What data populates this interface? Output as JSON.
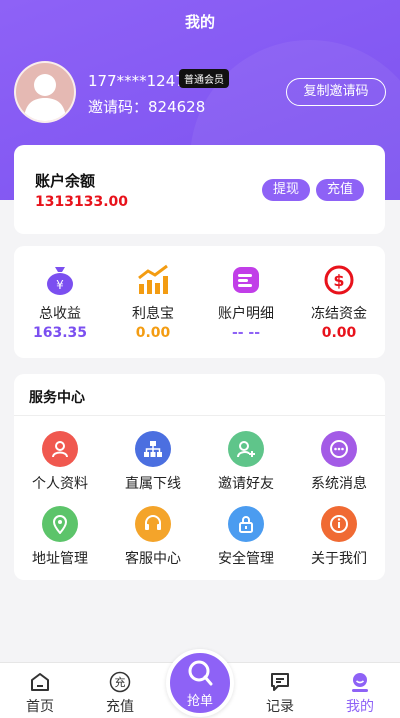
{
  "header": {
    "title": "我的"
  },
  "profile": {
    "phone": "177****1247",
    "member_badge": "普通会员",
    "invite_code": "邀请码：824628",
    "copy_invite_label": "复制邀请码"
  },
  "balance": {
    "label": "账户余额",
    "value": "1313133.00",
    "withdraw_label": "提现",
    "recharge_label": "充值"
  },
  "stats": [
    {
      "label": "总收益",
      "value": "163.35",
      "color": "#7b4ff0",
      "icon": "money-bag-icon"
    },
    {
      "label": "利息宝",
      "value": "0.00",
      "color": "#f39c12",
      "icon": "trend-chart-icon"
    },
    {
      "label": "账户明细",
      "value": "-- --",
      "color": "#8e62f6",
      "icon": "account-detail-icon"
    },
    {
      "label": "冻结资金",
      "value": "0.00",
      "color": "#e8121b",
      "icon": "dollar-coin-icon"
    }
  ],
  "services": {
    "title": "服务中心",
    "items": [
      {
        "label": "个人资料",
        "icon": "user-icon",
        "color": "#f0584f"
      },
      {
        "label": "直属下线",
        "icon": "hierarchy-icon",
        "color": "#4b6fe0"
      },
      {
        "label": "邀请好友",
        "icon": "add-user-icon",
        "color": "#5fc58a"
      },
      {
        "label": "系统消息",
        "icon": "message-icon",
        "color": "#a35be6"
      },
      {
        "label": "地址管理",
        "icon": "location-icon",
        "color": "#5cc46a"
      },
      {
        "label": "客服中心",
        "icon": "headset-icon",
        "color": "#f4a42a"
      },
      {
        "label": "安全管理",
        "icon": "lock-icon",
        "color": "#4b9cf0"
      },
      {
        "label": "关于我们",
        "icon": "info-icon",
        "color": "#f06a33"
      }
    ]
  },
  "tabbar": {
    "home": "首页",
    "recharge": "充值",
    "recharge_icon_char": "充",
    "grab": "抢单",
    "records": "记录",
    "mine": "我的"
  },
  "colors": {
    "accent": "#8e62f6",
    "danger": "#e8121b"
  }
}
